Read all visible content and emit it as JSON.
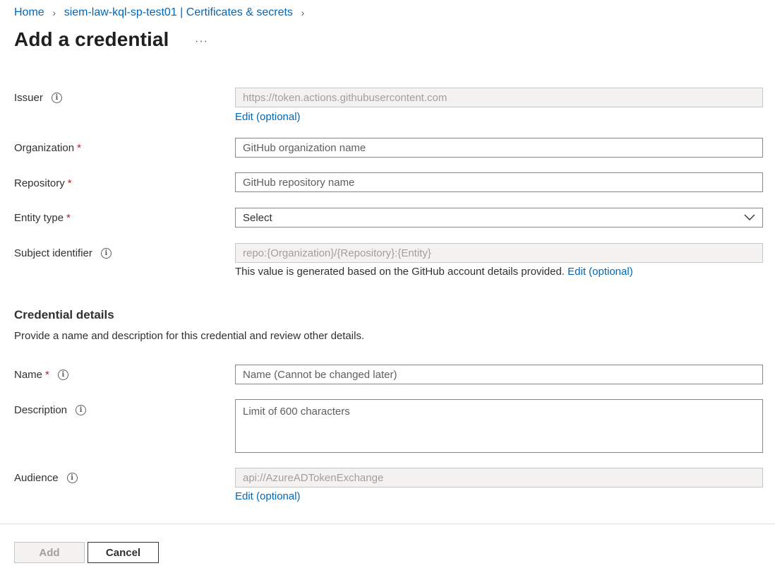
{
  "breadcrumb": {
    "home": "Home",
    "app": "siem-law-kql-sp-test01 | Certificates & secrets"
  },
  "page": {
    "title": "Add a credential",
    "more": "···"
  },
  "form": {
    "issuer": {
      "label": "Issuer",
      "value": "https://token.actions.githubusercontent.com",
      "edit": "Edit (optional)"
    },
    "organization": {
      "label": "Organization",
      "required": "*",
      "placeholder": "GitHub organization name"
    },
    "repository": {
      "label": "Repository",
      "required": "*",
      "placeholder": "GitHub repository name"
    },
    "entity_type": {
      "label": "Entity type",
      "required": "*",
      "selected": "Select"
    },
    "subject": {
      "label": "Subject identifier",
      "value": "repo:{Organization}/{Repository}:{Entity}",
      "help": "This value is generated based on the GitHub account details provided.",
      "edit": "Edit (optional)"
    }
  },
  "credential_details": {
    "title": "Credential details",
    "description": "Provide a name and description for this credential and review other details.",
    "name": {
      "label": "Name",
      "required": "*",
      "placeholder": "Name (Cannot be changed later)"
    },
    "desc_field": {
      "label": "Description",
      "placeholder": "Limit of 600 characters"
    },
    "audience": {
      "label": "Audience",
      "value": "api://AzureADTokenExchange",
      "edit": "Edit (optional)"
    }
  },
  "footer": {
    "add": "Add",
    "cancel": "Cancel"
  },
  "icons": {
    "info": "info-icon",
    "chevron": "chevron-right-icon",
    "dropdown": "chevron-down-icon"
  }
}
